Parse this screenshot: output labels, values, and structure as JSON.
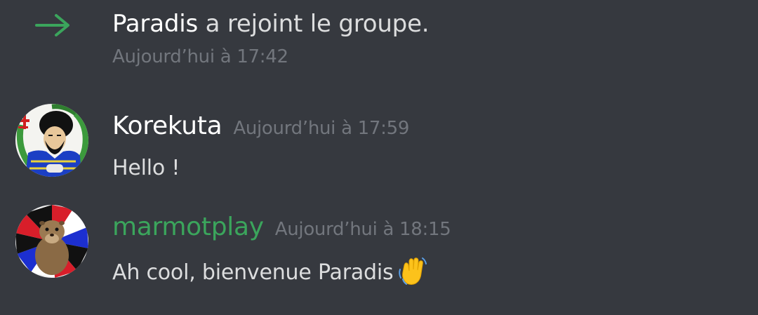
{
  "system_message": {
    "icon": "join-arrow-icon",
    "name": "Paradis",
    "text": " a rejoint le groupe.",
    "timestamp": "Aujourd’hui à 17:42"
  },
  "messages": [
    {
      "avatar_icon": "samurai-avatar",
      "author": "Korekuta",
      "author_color": "#ffffff",
      "timestamp": "Aujourd’hui à 17:59",
      "content": "Hello !"
    },
    {
      "avatar_icon": "marmot-avatar",
      "author": "marmotplay",
      "author_color": "#3ba55c",
      "timestamp": "Aujourd’hui à 18:15",
      "content": "Ah cool, bienvenue Paradis",
      "emoji": "waving-hand-emoji"
    }
  ],
  "colors": {
    "background": "#36393f",
    "join_arrow": "#3ba55c",
    "timestamp": "#72767d",
    "text": "#dcddde"
  }
}
